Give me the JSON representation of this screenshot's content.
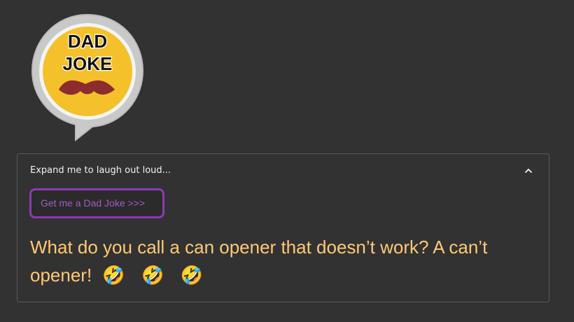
{
  "logo": {
    "line1": "DAD",
    "line2": "JOKE",
    "ring_color": "#c8c8c8",
    "face_color": "#f5c12a",
    "mustache_color": "#8d2c2d"
  },
  "expander": {
    "title": "Expand me to laugh out loud...",
    "state": "expanded",
    "chevron_icon": "chevron-up-icon"
  },
  "button": {
    "label": "Get me a Dad Joke >>>",
    "accent_color": "#8b3ab6"
  },
  "joke": {
    "text": "What do you call a can opener that doesn’t work? A can’t opener!",
    "emojis": "🤣 🤣 🤣",
    "text_color": "#ffc978"
  }
}
